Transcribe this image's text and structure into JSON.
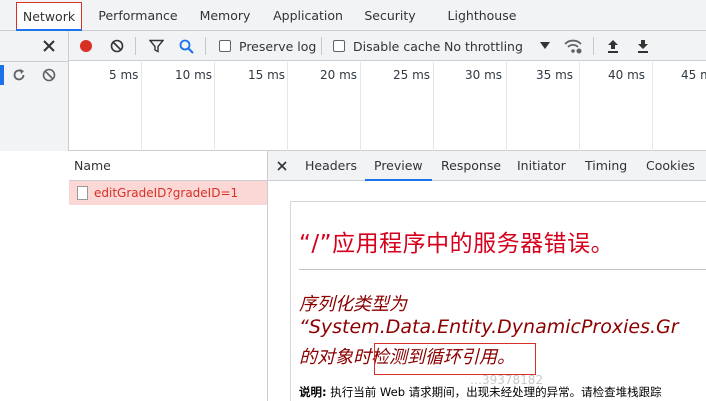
{
  "tabs": [
    "Network",
    "Performance",
    "Memory",
    "Application",
    "Security",
    "Lighthouse"
  ],
  "toolbar": {
    "preserve_log_label": "Preserve log",
    "disable_cache_label": "Disable cache",
    "throttling_value": "No throttling"
  },
  "timeline": {
    "ticks": [
      "5 ms",
      "10 ms",
      "15 ms",
      "20 ms",
      "25 ms",
      "30 ms",
      "35 ms",
      "40 ms",
      "45 m"
    ]
  },
  "request_list": {
    "header": "Name",
    "rows": [
      "editGradeID?gradeID=1"
    ]
  },
  "details": {
    "tabs": [
      "Headers",
      "Preview",
      "Response",
      "Initiator",
      "Timing",
      "Cookies"
    ],
    "active_tab": "Preview"
  },
  "preview": {
    "title": "“/”应用程序中的服务器错误。",
    "message_line1": "序列化类型为",
    "message_line2": "“System.Data.Entity.DynamicProxies.Gr",
    "message_line3": "的对象时检测到循环引用。",
    "description_label": "说明:",
    "description_text": "执行当前 Web 请求期间，出现未经处理的异常。请检查堆栈跟踪"
  },
  "watermark": "…39378182",
  "colors": {
    "accent": "#1a73e8",
    "record": "#d93025",
    "error_title": "#d6001c",
    "error_message": "#8b0000",
    "selected_row_bg": "#fbd7d6"
  },
  "icons": [
    "clear-icon",
    "record-icon",
    "stop-icon",
    "filter-icon",
    "search-icon",
    "dropdown-icon",
    "wifi-settings-icon",
    "upload-icon",
    "download-icon",
    "reload-icon",
    "block-icon",
    "close-icon"
  ]
}
